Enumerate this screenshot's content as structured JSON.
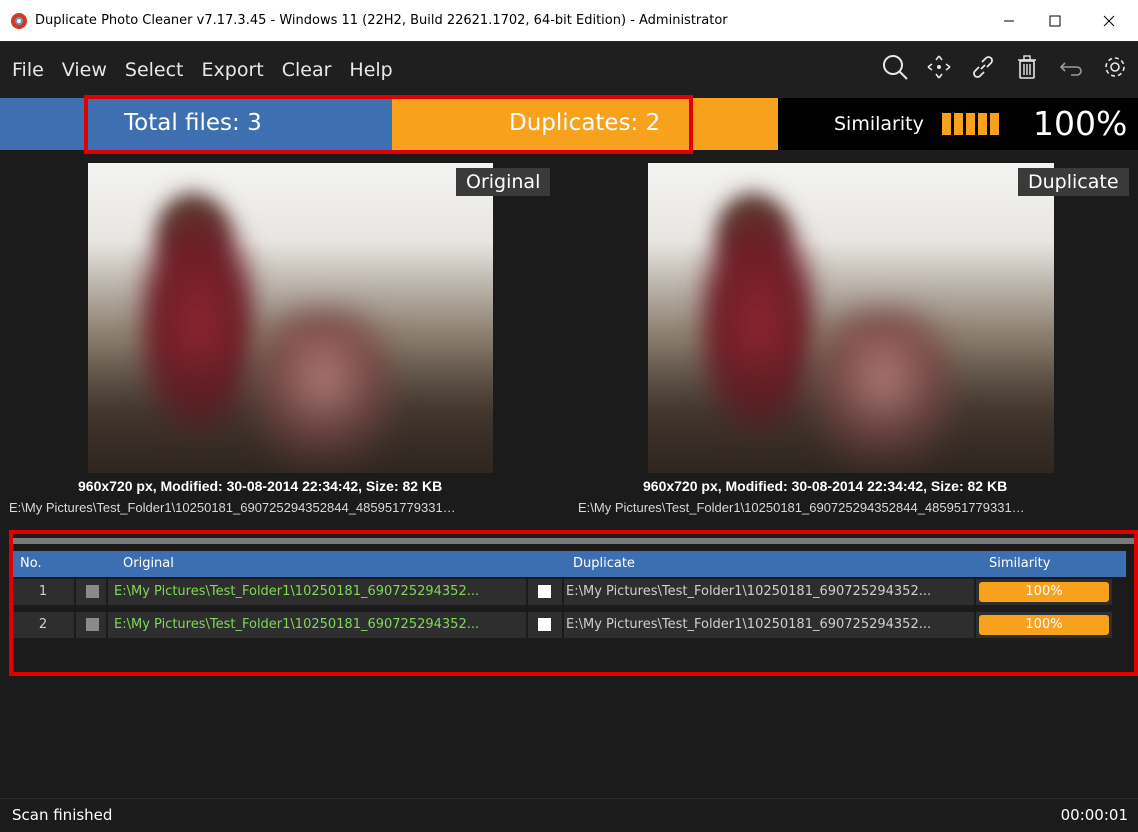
{
  "window": {
    "title": "Duplicate Photo Cleaner v7.17.3.45 - Windows 11 (22H2, Build 22621.1702, 64-bit Edition) - Administrator",
    "controls": [
      "minimize",
      "maximize",
      "close"
    ]
  },
  "menu": {
    "items": [
      "File",
      "View",
      "Select",
      "Export",
      "Clear",
      "Help"
    ]
  },
  "toolbar": {
    "icons": [
      "search-icon",
      "move-icon",
      "link-icon",
      "trash-icon",
      "undo-icon",
      "gear-icon"
    ]
  },
  "stats": {
    "total_files": "Total files: 3",
    "duplicates": "Duplicates: 2",
    "similarity_label": "Similarity",
    "similarity_value": "100%",
    "similarity_level": 1.0
  },
  "preview": {
    "original": {
      "tag": "Original",
      "info": "960x720 px, Modified: 30-08-2014 22:34:42, Size: 82 KB",
      "path": "E:\\My Pictures\\Test_Folder1\\10250181_690725294352844_485951779331…"
    },
    "duplicate": {
      "tag": "Duplicate",
      "info": "960x720 px, Modified: 30-08-2014 22:34:42, Size: 82 KB",
      "path": "E:\\My Pictures\\Test_Folder1\\10250181_690725294352844_485951779331…"
    }
  },
  "table": {
    "columns": {
      "no": "No.",
      "original": "Original",
      "duplicate": "Duplicate",
      "similarity": "Similarity"
    },
    "rows": [
      {
        "no": "1",
        "original": "E:\\My Pictures\\Test_Folder1\\10250181_690725294352...",
        "duplicate": "E:\\My Pictures\\Test_Folder1\\10250181_690725294352...",
        "similarity": "100%"
      },
      {
        "no": "2",
        "original": "E:\\My Pictures\\Test_Folder1\\10250181_690725294352...",
        "duplicate": "E:\\My Pictures\\Test_Folder1\\10250181_690725294352...",
        "similarity": "100%"
      }
    ]
  },
  "status": {
    "left": "Scan finished",
    "right": "00:00:01"
  },
  "colors": {
    "blue": "#3e6fb0",
    "orange": "#f7a11d",
    "green_path": "#7ed957",
    "highlight_red": "#e00000"
  }
}
